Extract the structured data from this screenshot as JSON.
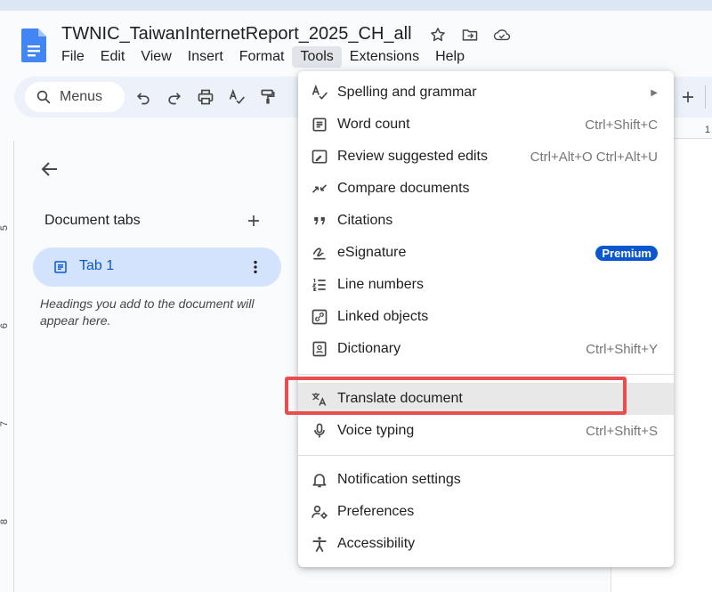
{
  "document": {
    "title": "TWNIC_TaiwanInternetReport_2025_CH_all"
  },
  "menubar": {
    "items": [
      "File",
      "Edit",
      "View",
      "Insert",
      "Format",
      "Tools",
      "Extensions",
      "Help"
    ],
    "active": "Tools"
  },
  "toolbar": {
    "search_label": "Menus"
  },
  "ruler": {
    "top_number": "1",
    "left_numbers": [
      "5",
      "6",
      "7",
      "8"
    ]
  },
  "side_panel": {
    "title": "Document tabs",
    "tab_label": "Tab 1",
    "hint": "Headings you add to the document will appear here."
  },
  "tools_menu": {
    "items": [
      {
        "label": "Spelling and grammar",
        "shortcut": "",
        "icon": "spellcheck-icon"
      },
      {
        "label": "Word count",
        "shortcut": "Ctrl+Shift+C",
        "icon": "word-count-icon"
      },
      {
        "label": "Review suggested edits",
        "shortcut": "Ctrl+Alt+O Ctrl+Alt+U",
        "icon": "review-edits-icon"
      },
      {
        "label": "Compare documents",
        "shortcut": "",
        "icon": "compare-icon"
      },
      {
        "label": "Citations",
        "shortcut": "",
        "icon": "quote-icon"
      },
      {
        "label": "eSignature",
        "shortcut": "",
        "icon": "signature-icon",
        "badge": "Premium"
      },
      {
        "label": "Line numbers",
        "shortcut": "",
        "icon": "line-numbers-icon"
      },
      {
        "label": "Linked objects",
        "shortcut": "",
        "icon": "link-icon"
      },
      {
        "label": "Dictionary",
        "shortcut": "Ctrl+Shift+Y",
        "icon": "dictionary-icon"
      },
      {
        "label": "Translate document",
        "shortcut": "",
        "icon": "translate-icon"
      },
      {
        "label": "Voice typing",
        "shortcut": "Ctrl+Shift+S",
        "icon": "microphone-icon"
      },
      {
        "label": "Notification settings",
        "shortcut": "",
        "icon": "bell-icon"
      },
      {
        "label": "Preferences",
        "shortcut": "",
        "icon": "preferences-icon"
      },
      {
        "label": "Accessibility",
        "shortcut": "",
        "icon": "accessibility-icon"
      }
    ]
  },
  "colors": {
    "accent": "#0b57d0",
    "callout": "#e94d4d",
    "tab_bg": "#d3e3fd",
    "toolbar_bg": "#edf2fa"
  }
}
